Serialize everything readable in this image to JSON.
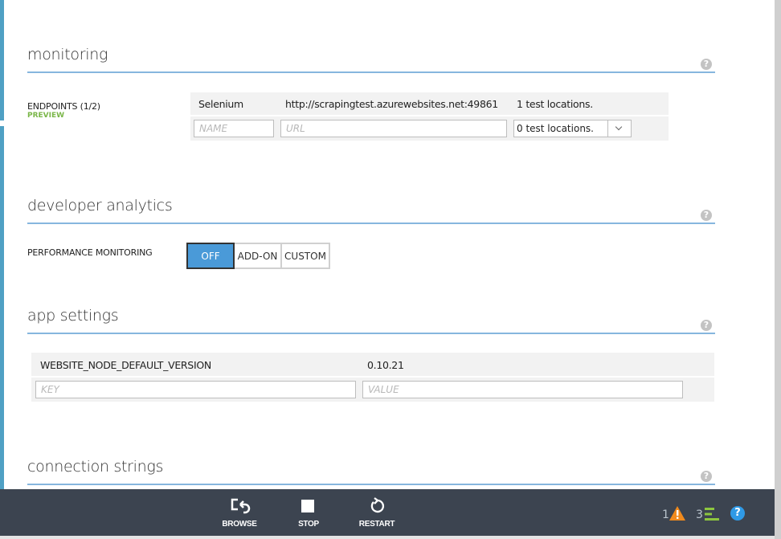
{
  "sections": {
    "monitoring": {
      "title": "monitoring",
      "endpoints_label": "ENDPOINTS (1/2)",
      "preview_badge": "PREVIEW",
      "rows": [
        {
          "name": "Selenium",
          "url": "http://scrapingtest.azurewebsites.net:49861",
          "locations": "1 test locations."
        }
      ],
      "new_row": {
        "name_placeholder": "NAME",
        "url_placeholder": "URL",
        "locations_selected": "0 test locations."
      }
    },
    "developer_analytics": {
      "title": "developer analytics",
      "performance_label": "PERFORMANCE MONITORING",
      "options": [
        "OFF",
        "ADD-ON",
        "CUSTOM"
      ],
      "selected": "OFF"
    },
    "app_settings": {
      "title": "app settings",
      "rows": [
        {
          "key": "WEBSITE_NODE_DEFAULT_VERSION",
          "value": "0.10.21"
        }
      ],
      "new_row": {
        "key_placeholder": "KEY",
        "value_placeholder": "VALUE"
      }
    },
    "connection_strings": {
      "title": "connection strings"
    }
  },
  "help_icon_glyph": "?",
  "command_bar": {
    "commands": [
      {
        "label": "BROWSE",
        "icon": "browse-icon"
      },
      {
        "label": "STOP",
        "icon": "stop-icon"
      },
      {
        "label": "RESTART",
        "icon": "restart-icon"
      }
    ],
    "status": {
      "warnings_count": "1",
      "operations_count": "3",
      "help_glyph": "?"
    }
  },
  "colors": {
    "accent_blue": "#4a9ad8",
    "preview_green": "#7ab648",
    "warning_orange": "#f08a1d",
    "command_bar": "#3c4450"
  }
}
